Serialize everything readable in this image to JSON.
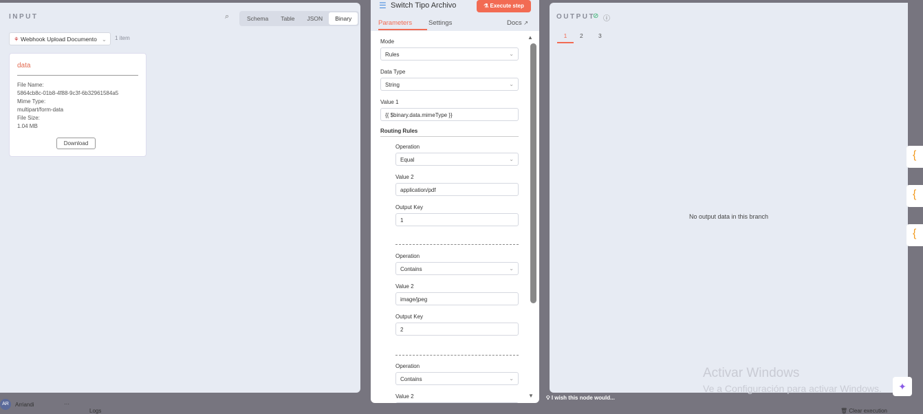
{
  "input": {
    "title": "INPUT",
    "tabs": [
      "Schema",
      "Table",
      "JSON",
      "Binary"
    ],
    "active_tab": "Binary",
    "node": "Webhook Upload Documento",
    "count": "1 item",
    "card": {
      "name": "data",
      "file_name_label": "File Name:",
      "file_name": "5864cb8c-01b8-4f88-9c3f-6b32961584a5",
      "mime_label": "Mime Type:",
      "mime": "multipart/form-data",
      "size_label": "File Size:",
      "size": "1.04 MB",
      "download": "Download"
    }
  },
  "node": {
    "title": "Switch Tipo Archivo",
    "execute": "Execute step",
    "tabs": [
      "Parameters",
      "Settings"
    ],
    "docs": "Docs",
    "mode_label": "Mode",
    "mode": "Rules",
    "dtype_label": "Data Type",
    "dtype": "String",
    "value1_label": "Value 1",
    "value1": "{{ $binary.data.mimeType }}",
    "routing": "Routing Rules",
    "rules": [
      {
        "op_label": "Operation",
        "op": "Equal",
        "v2_label": "Value 2",
        "v2": "application/pdf",
        "key_label": "Output Key",
        "key": "1"
      },
      {
        "op_label": "Operation",
        "op": "Contains",
        "v2_label": "Value 2",
        "v2": "image/jpeg",
        "key_label": "Output Key",
        "key": "2"
      },
      {
        "op_label": "Operation",
        "op": "Contains",
        "v2_label": "Value 2"
      }
    ]
  },
  "output": {
    "title": "OUTPUT",
    "branches": [
      "1",
      "2",
      "3"
    ],
    "empty": "No output data in this branch"
  },
  "footer": {
    "wish": "I wish this node would...",
    "user": "Arriandi",
    "initials": "AR",
    "logs": "Logs",
    "clear": "Clear execution"
  },
  "watermark": {
    "line1": "Activar Windows",
    "line2": "Ve a Configuración para activar Windows."
  }
}
